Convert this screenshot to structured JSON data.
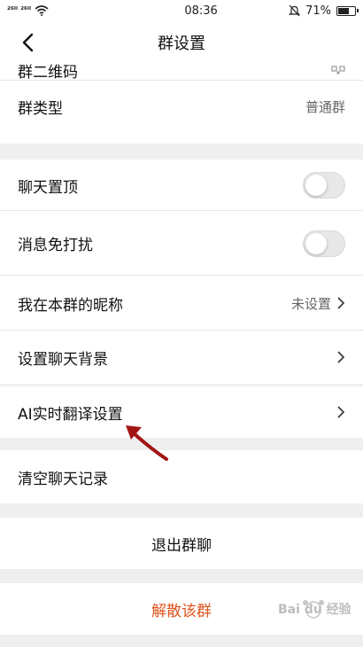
{
  "status_bar": {
    "signal_text": "²⁶ᴵˡ ²⁶ᴵˡ",
    "time": "08:36",
    "battery": "71%",
    "battery_level": 0.71,
    "icons": [
      "signal-icon",
      "wifi-icon",
      "mute-bell-icon",
      "battery-icon"
    ]
  },
  "nav": {
    "title": "群设置",
    "back_icon": "chevron-left-icon"
  },
  "sections": {
    "qr": {
      "label": "群二维码"
    },
    "group_type": {
      "label": "群类型",
      "value": "普通群"
    },
    "pin_chat": {
      "label": "聊天置顶",
      "on": false
    },
    "mute": {
      "label": "消息免打扰",
      "on": false
    },
    "nickname": {
      "label": "我在本群的昵称",
      "value": "未设置"
    },
    "background": {
      "label": "设置聊天背景"
    },
    "ai_translate": {
      "label": "AI实时翻译设置"
    },
    "clear_history": {
      "label": "清空聊天记录"
    },
    "exit_group": {
      "label": "退出群聊"
    },
    "dissolve_group": {
      "label": "解散该群"
    }
  },
  "colors": {
    "danger": "#e0541d",
    "annotation_arrow": "#a31515",
    "page_bg": "#efefef"
  },
  "watermark": {
    "text": "Bai du 经验"
  }
}
